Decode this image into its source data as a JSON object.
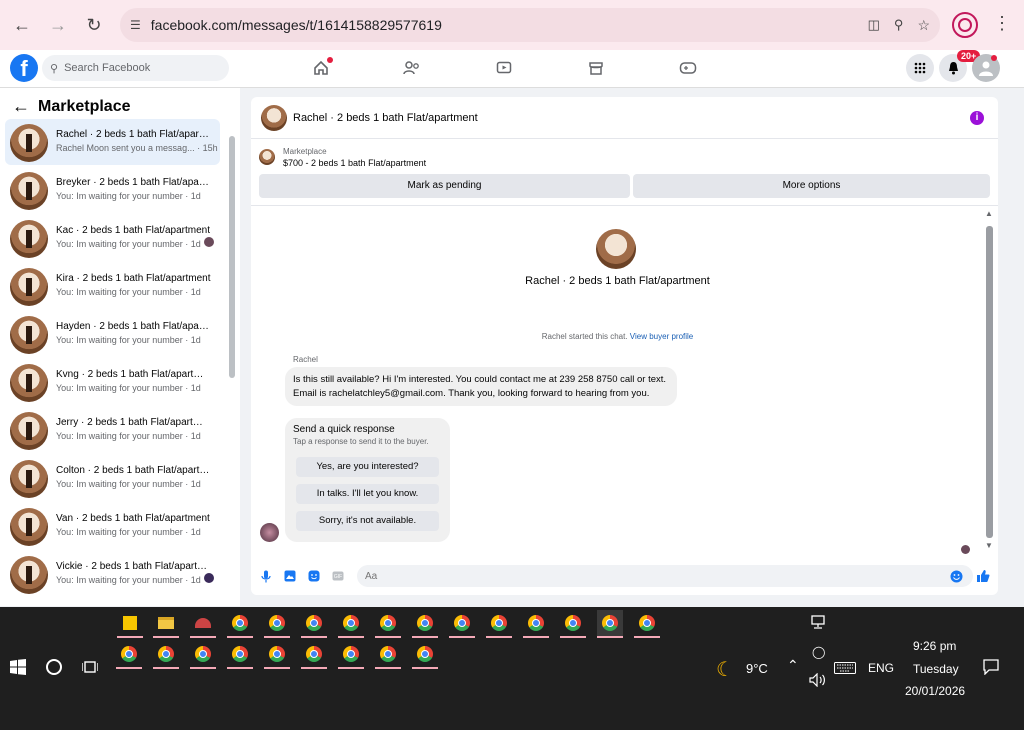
{
  "browser": {
    "url": "facebook.com/messages/t/1614158829577619"
  },
  "facebook": {
    "search_placeholder": "Search Facebook",
    "notifications_badge": "20+"
  },
  "sidebar": {
    "title": "Marketplace",
    "conversations": [
      {
        "name": "Rachel · 2 beds 1 bath Flat/apartment",
        "preview": "Rachel Moon sent you a messag... · 15h"
      },
      {
        "name": "Breyker · 2 beds 1 bath Flat/apartment",
        "preview": "You: Im waiting for your number · 1d"
      },
      {
        "name": "Kac · 2 beds 1 bath Flat/apartment",
        "preview": "You: Im waiting for your number · 1d"
      },
      {
        "name": "Kira · 2 beds 1 bath Flat/apartment",
        "preview": "You: Im waiting for your number · 1d"
      },
      {
        "name": "Hayden · 2 beds 1 bath Flat/apartment",
        "preview": "You: Im waiting for your number · 1d"
      },
      {
        "name": "Kvng · 2 beds 1 bath Flat/apartment",
        "preview": "You: Im waiting for your number · 1d"
      },
      {
        "name": "Jerry · 2 beds 1 bath Flat/apartment",
        "preview": "You: Im waiting for your number · 1d"
      },
      {
        "name": "Colton · 2 beds 1 bath Flat/apartment",
        "preview": "You: Im waiting for your number · 1d"
      },
      {
        "name": "Van · 2 beds 1 bath Flat/apartment",
        "preview": "You: Im waiting for your number · 1d"
      },
      {
        "name": "Vickie · 2 beds 1 bath Flat/apartment",
        "preview": "You: Im waiting for your number · 1d"
      }
    ]
  },
  "chat": {
    "title": "Rachel · 2 beds 1 bath Flat/apartment",
    "listing_source": "Marketplace",
    "listing_price_line": "$700 - 2 beds 1 bath Flat/apartment",
    "mark_pending_label": "Mark as pending",
    "more_options_label": "More options",
    "center_name": "Rachel · 2 beds 1 bath Flat/apartment",
    "system_message": "Rachel started this chat.",
    "view_profile_link": "View buyer profile",
    "sender": "Rachel",
    "message": "Is this still available? Hi I'm interested. You could contact me at 239 258 8750 call or text. Email is rachelatchley5@gmail.com. Thank you, looking forward to hearing from you.",
    "quick_response": {
      "title": "Send a quick response",
      "subtitle": "Tap a response to send it to the buyer.",
      "options": [
        "Yes, are you interested?",
        "In talks. I'll let you know.",
        "Sorry, it's not available."
      ]
    },
    "composer_placeholder": "Aa"
  },
  "taskbar": {
    "weather_temp": "9°C",
    "language": "ENG",
    "time": "9:26 pm",
    "day": "Tuesday",
    "date": "20/01/2026"
  }
}
